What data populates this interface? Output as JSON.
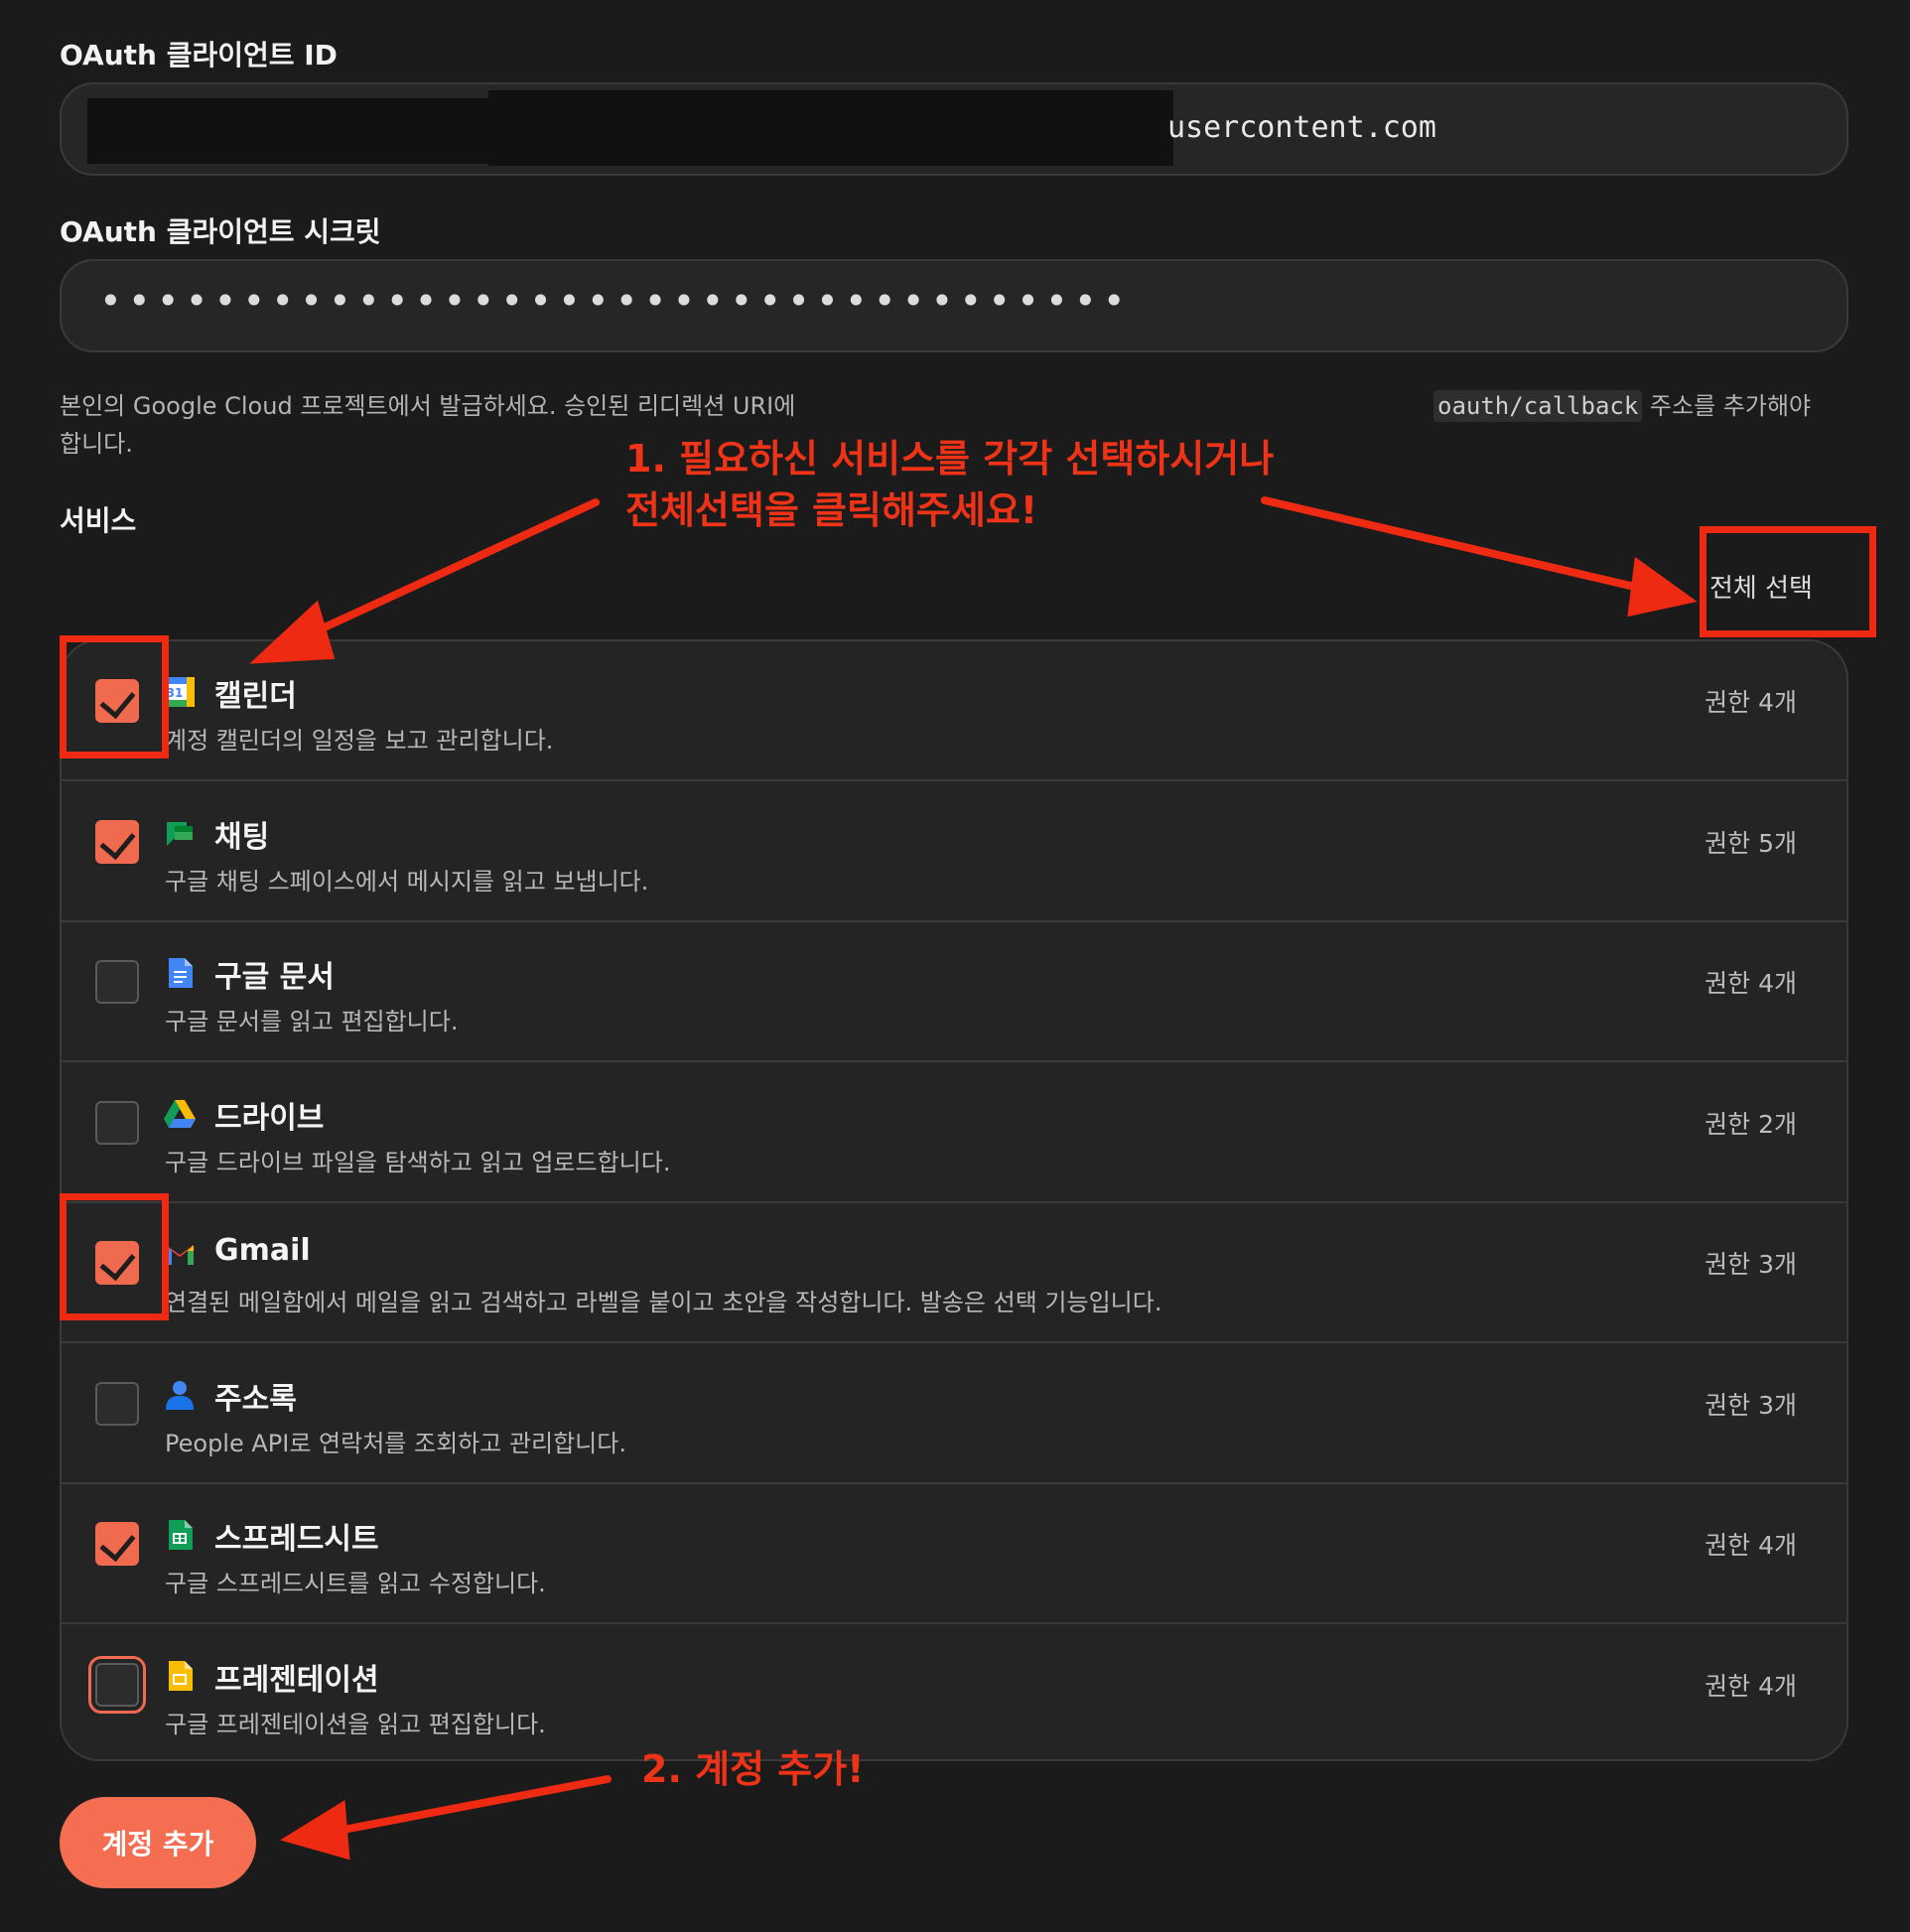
{
  "client_id": {
    "label": "OAuth 클라이언트 ID",
    "value_visible_suffix": "usercontent.com"
  },
  "client_secret": {
    "label": "OAuth 클라이언트 시크릿",
    "masked_value": "••••••••••••••••••••••••••••••••••••"
  },
  "help": {
    "line1_a": "본인의 Google Cloud 프로젝트에서 발급하세요. 승인된 리디렉션 URI에",
    "code": "oauth/callback",
    "line1_b": " 주소를 추가해야",
    "line2": "합니다."
  },
  "services": {
    "heading": "서비스",
    "select_all": "전체 선택",
    "items": [
      {
        "name": "캘린더",
        "desc": "계정 캘린더의 일정을 보고 관리합니다.",
        "perm": "권한 4개",
        "checked": true,
        "icon": "calendar-icon"
      },
      {
        "name": "채팅",
        "desc": "구글 채팅 스페이스에서 메시지를 읽고 보냅니다.",
        "perm": "권한 5개",
        "checked": true,
        "icon": "chat-icon"
      },
      {
        "name": "구글 문서",
        "desc": "구글 문서를 읽고 편집합니다.",
        "perm": "권한 4개",
        "checked": false,
        "icon": "docs-icon"
      },
      {
        "name": "드라이브",
        "desc": "구글 드라이브 파일을 탐색하고 읽고 업로드합니다.",
        "perm": "권한 2개",
        "checked": false,
        "icon": "drive-icon"
      },
      {
        "name": "Gmail",
        "desc": "연결된 메일함에서 메일을 읽고 검색하고 라벨을 붙이고 초안을 작성합니다. 발송은 선택 기능입니다.",
        "perm": "권한 3개",
        "checked": true,
        "icon": "gmail-icon"
      },
      {
        "name": "주소록",
        "desc": "People API로 연락처를 조회하고 관리합니다.",
        "perm": "권한 3개",
        "checked": false,
        "icon": "contacts-icon"
      },
      {
        "name": "스프레드시트",
        "desc": "구글 스프레드시트를 읽고 수정합니다.",
        "perm": "권한 4개",
        "checked": true,
        "icon": "sheets-icon"
      },
      {
        "name": "프레젠테이션",
        "desc": "구글 프레젠테이션을 읽고 편집합니다.",
        "perm": "권한 4개",
        "checked": false,
        "icon": "slides-icon"
      }
    ]
  },
  "add_account_label": "계정 추가",
  "annotations": {
    "step1_line1": "1. 필요하신 서비스를 각각 선택하시거나",
    "step1_line2": "전체선택을 클릭해주세요!",
    "step2": "2. 계정 추가!",
    "color": "#ee2a12"
  },
  "colors": {
    "accent": "#f56e52",
    "background": "#1b1b1b"
  }
}
